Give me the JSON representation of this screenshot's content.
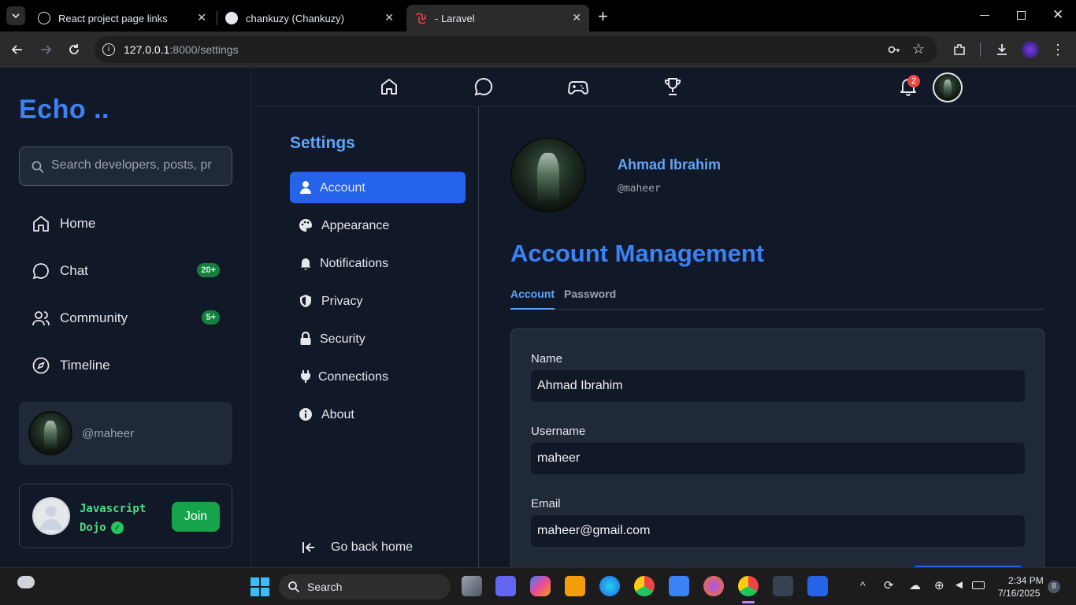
{
  "browser": {
    "tabs": [
      {
        "title": "React project page links",
        "favicon": "openai-icon"
      },
      {
        "title": "chankuzy (Chankuzy)",
        "favicon": "github-icon"
      },
      {
        "title": "- Laravel",
        "favicon": "laravel-icon",
        "active": true
      }
    ],
    "url_host": "127.0.0.1",
    "url_path": ":8000/settings"
  },
  "sidebar": {
    "logo": "Echo ..",
    "search_placeholder": "Search developers, posts, pr",
    "nav": [
      {
        "label": "Home",
        "icon": "home-icon"
      },
      {
        "label": "Chat",
        "icon": "chat-icon",
        "badge": "20+"
      },
      {
        "label": "Community",
        "icon": "users-icon",
        "badge": "5+"
      },
      {
        "label": "Timeline",
        "icon": "compass-icon"
      }
    ],
    "user_handle": "@maheer",
    "group": {
      "name": "Javascript Dojo",
      "join_label": "Join"
    }
  },
  "topnav": {
    "icons": [
      "home-icon",
      "chat-icon",
      "gamepad-icon",
      "trophy-icon"
    ],
    "notification_count": "2"
  },
  "settings": {
    "title": "Settings",
    "items": [
      {
        "label": "Account",
        "icon": "user-icon",
        "active": true
      },
      {
        "label": "Appearance",
        "icon": "palette-icon"
      },
      {
        "label": "Notifications",
        "icon": "bell-icon"
      },
      {
        "label": "Privacy",
        "icon": "shield-icon"
      },
      {
        "label": "Security",
        "icon": "lock-icon"
      },
      {
        "label": "Connections",
        "icon": "plug-icon"
      },
      {
        "label": "About",
        "icon": "info-icon"
      }
    ],
    "go_back": "Go back home"
  },
  "profile": {
    "name": "Ahmad Ibrahim",
    "handle": "@maheer"
  },
  "main": {
    "title": "Account Management",
    "tabs": [
      "Account",
      "Password"
    ],
    "form": {
      "name_label": "Name",
      "name_value": "Ahmad Ibrahim",
      "username_label": "Username",
      "username_value": "maheer",
      "email_label": "Email",
      "email_value": "maheer@gmail.com"
    }
  },
  "taskbar": {
    "search_label": "Search",
    "time": "2:34 PM",
    "date": "7/16/2025",
    "notification_count": "8"
  },
  "colors": {
    "accent": "#3b82f6",
    "active_nav": "#2563eb",
    "badge_green": "#15803d",
    "background": "#111827"
  }
}
